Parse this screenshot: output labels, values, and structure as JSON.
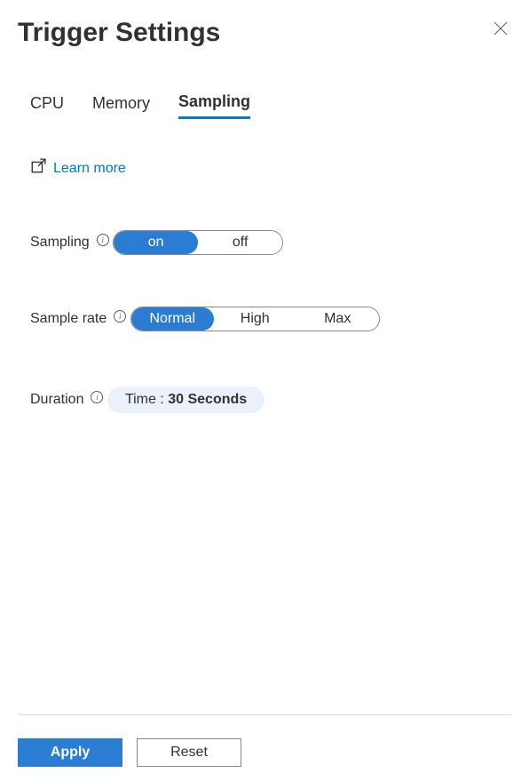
{
  "header": {
    "title": "Trigger Settings"
  },
  "tabs": {
    "items": [
      {
        "label": "CPU"
      },
      {
        "label": "Memory"
      },
      {
        "label": "Sampling"
      }
    ],
    "active_index": 2
  },
  "learn_more": {
    "label": "Learn more"
  },
  "fields": {
    "sampling": {
      "label": "Sampling",
      "options": [
        {
          "label": "on"
        },
        {
          "label": "off"
        }
      ],
      "selected_index": 0
    },
    "sample_rate": {
      "label": "Sample rate",
      "options": [
        {
          "label": "Normal"
        },
        {
          "label": "High"
        },
        {
          "label": "Max"
        }
      ],
      "selected_index": 0
    },
    "duration": {
      "label": "Duration",
      "prefix": "Time : ",
      "value": "30 Seconds"
    }
  },
  "footer": {
    "apply": "Apply",
    "reset": "Reset"
  }
}
